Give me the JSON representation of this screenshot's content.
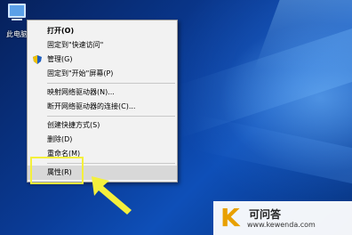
{
  "desktop": {
    "icon_label": "此电脑",
    "icon_name": "computer-icon"
  },
  "context_menu": {
    "groups": [
      [
        {
          "label": "打开(O)",
          "bold": true
        },
        {
          "label": "固定到\"快速访问\""
        },
        {
          "label": "管理(G)",
          "icon": "shield-icon"
        },
        {
          "label": "固定到\"开始\"屏幕(P)"
        }
      ],
      [
        {
          "label": "映射网络驱动器(N)..."
        },
        {
          "label": "断开网络驱动器的连接(C)..."
        }
      ],
      [
        {
          "label": "创建快捷方式(S)"
        },
        {
          "label": "删除(D)"
        },
        {
          "label": "重命名(M)"
        }
      ],
      [
        {
          "label": "属性(R)",
          "highlighted": true
        }
      ]
    ]
  },
  "annotation": {
    "color": "#f4f03c"
  },
  "watermark": {
    "logo": "K",
    "title": "可问答",
    "url": "www.kewenda.com"
  }
}
